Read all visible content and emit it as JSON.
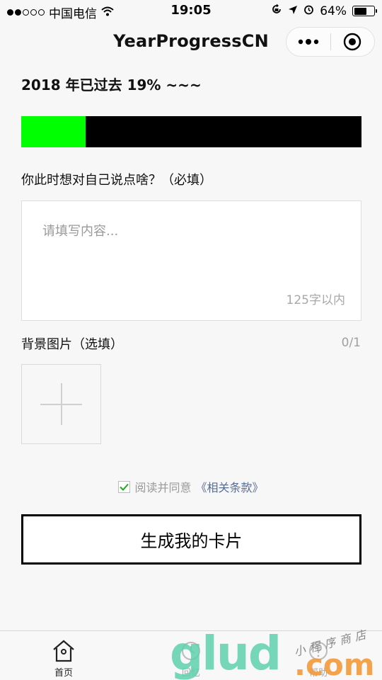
{
  "status_bar": {
    "carrier": "中国电信",
    "time": "19:05",
    "battery": "64%",
    "battery_level": 0.64,
    "signal_bars_filled": 2,
    "signal_bars_total": 5
  },
  "nav": {
    "title": "YearProgressCN",
    "more_icon": "more-dots-icon",
    "close_icon": "target-circle-icon"
  },
  "progress": {
    "text": "2018 年已过去 19% ~~~",
    "percent": 19,
    "fill_color": "#00ff00",
    "track_color": "#000000"
  },
  "message": {
    "label": "你此时想对自己说点啥？（必填）",
    "placeholder": "请填写内容...",
    "limit": "125字以内"
  },
  "background": {
    "label": "背景图片（选填）",
    "count": "0/1"
  },
  "agreement": {
    "text": "阅读并同意",
    "link": "《相关条款》",
    "checked": true
  },
  "generate_button": "生成我的卡片",
  "tabbar": {
    "home_label": "首页",
    "review_label": "回忆",
    "help_label": "帮助"
  },
  "watermark": {
    "brand": "glud",
    "domain": ".com",
    "shop": "小程序商店"
  }
}
